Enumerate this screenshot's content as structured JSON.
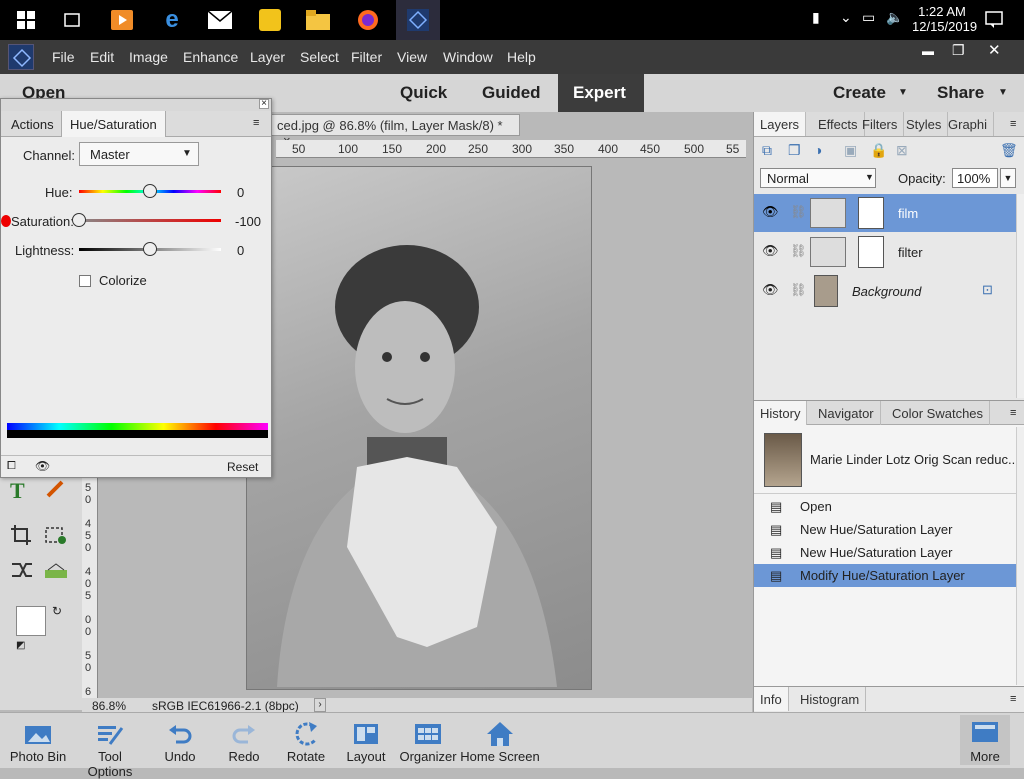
{
  "taskbar": {
    "time": "1:22 AM",
    "date": "12/15/2019"
  },
  "menu": {
    "items": [
      "File",
      "Edit",
      "Image",
      "Enhance",
      "Layer",
      "Select",
      "Filter",
      "View",
      "Window",
      "Help"
    ],
    "close": "✕",
    "minimize": "▬",
    "restore": "❐"
  },
  "modes": {
    "open": "Open",
    "quick": "Quick",
    "guided": "Guided",
    "expert": "Expert",
    "create": "Create",
    "share": "Share"
  },
  "document": {
    "tab_title": "ced.jpg @ 86.8% (film, Layer Mask/8) *",
    "close": "×",
    "zoom": "86.8%",
    "profile": "sRGB IEC61966-2.1 (8bpc)",
    "ruler_top": [
      "50",
      "100",
      "150",
      "200",
      "250",
      "300",
      "350",
      "400",
      "450",
      "500",
      "55"
    ],
    "ruler_left": [
      "5",
      "0",
      "4",
      "5",
      "0",
      "4",
      "0",
      "5",
      "0",
      "0",
      "5",
      "0",
      "6"
    ]
  },
  "huesat": {
    "tab_actions": "Actions",
    "tab_huesat": "Hue/Saturation",
    "channel_label": "Channel:",
    "channel_value": "Master",
    "hue_label": "Hue:",
    "hue_value": "0",
    "hue_level": 0,
    "sat_label": "Saturation:",
    "sat_value": "-100",
    "sat_level": -100,
    "light_label": "Lightness:",
    "light_value": "0",
    "light_level": 0,
    "colorize": "Colorize",
    "reset": "Reset"
  },
  "layers": {
    "tabs": [
      "Layers",
      "Effects",
      "Filters",
      "Styles",
      "Graphi"
    ],
    "blend": "Normal",
    "opacity_label": "Opacity:",
    "opacity": "100%",
    "items": [
      {
        "name": "film",
        "selected": true
      },
      {
        "name": "filter",
        "selected": false
      },
      {
        "name": "Background",
        "selected": false
      }
    ]
  },
  "history": {
    "tabs": [
      "History",
      "Navigator",
      "Color Swatches"
    ],
    "snapshot": "Marie Linder Lotz Orig Scan reduc...",
    "items": [
      {
        "label": "Open"
      },
      {
        "label": "New Hue/Saturation Layer"
      },
      {
        "label": "New Hue/Saturation Layer"
      },
      {
        "label": "Modify Hue/Saturation Layer",
        "selected": true
      }
    ]
  },
  "info": {
    "tabs": [
      "Info",
      "Histogram"
    ]
  },
  "bottom": {
    "items": [
      "Photo Bin",
      "Tool Options",
      "Undo",
      "Redo",
      "Rotate",
      "Layout",
      "Organizer",
      "Home Screen"
    ],
    "more": "More"
  },
  "colors": {
    "accent": "#5b86c5",
    "selected_row": "#6c97d6",
    "menu_bg": "#3a3a3a"
  }
}
